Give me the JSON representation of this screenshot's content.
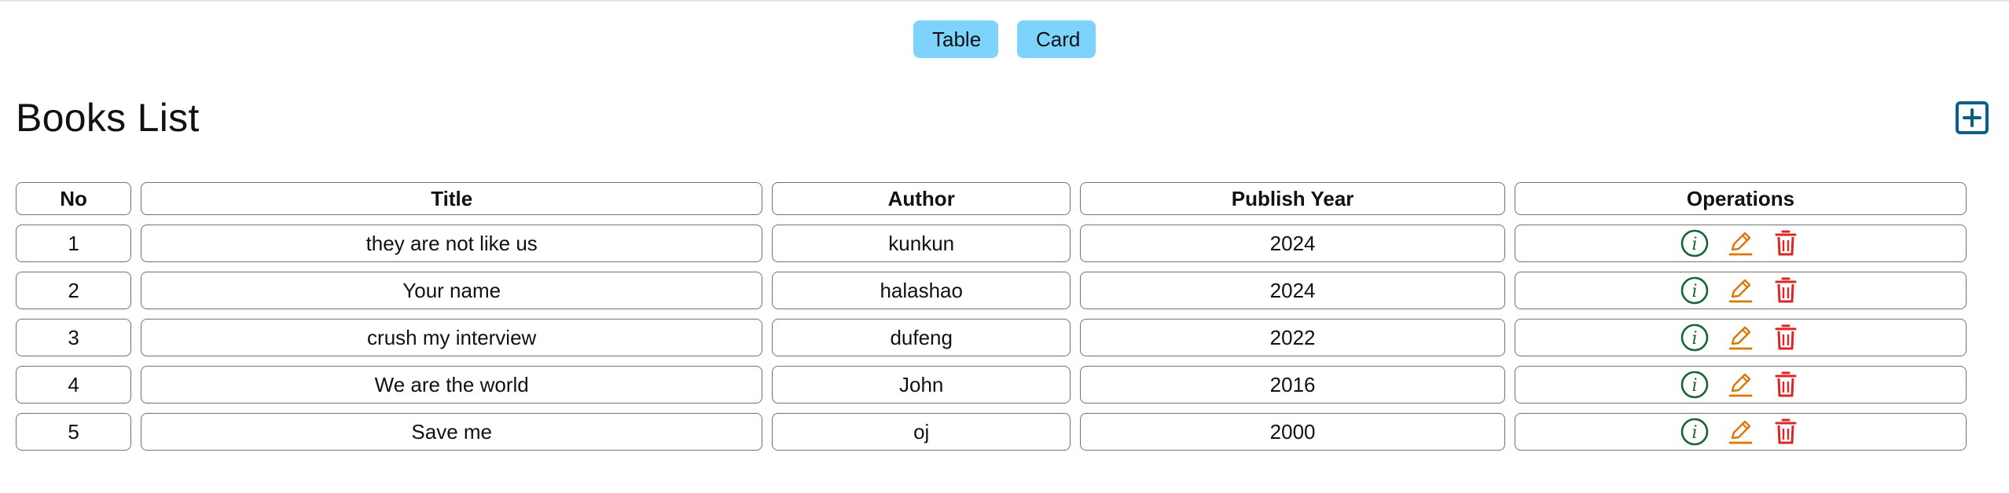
{
  "view_toggle": {
    "table_label": "Table",
    "card_label": "Card",
    "color": "#7dd3fc"
  },
  "header": {
    "title": "Books List",
    "add_icon": "plus-square-icon",
    "add_icon_color": "#0b5e86"
  },
  "table": {
    "columns": [
      "No",
      "Title",
      "Author",
      "Publish Year",
      "Operations"
    ],
    "rows": [
      {
        "no": "1",
        "title": "they are not like us",
        "author": "kunkun",
        "year": "2024"
      },
      {
        "no": "2",
        "title": "Your name",
        "author": "halashao",
        "year": "2024"
      },
      {
        "no": "3",
        "title": "crush my interview",
        "author": "dufeng",
        "year": "2022"
      },
      {
        "no": "4",
        "title": "We are the world",
        "author": "John",
        "year": "2016"
      },
      {
        "no": "5",
        "title": "Save me",
        "author": "oj",
        "year": "2000"
      }
    ],
    "operations": [
      {
        "icon": "info-circle-icon",
        "color": "#166534"
      },
      {
        "icon": "pencil-edit-icon",
        "color": "#d97706"
      },
      {
        "icon": "trash-delete-icon",
        "color": "#dc2626"
      }
    ]
  }
}
